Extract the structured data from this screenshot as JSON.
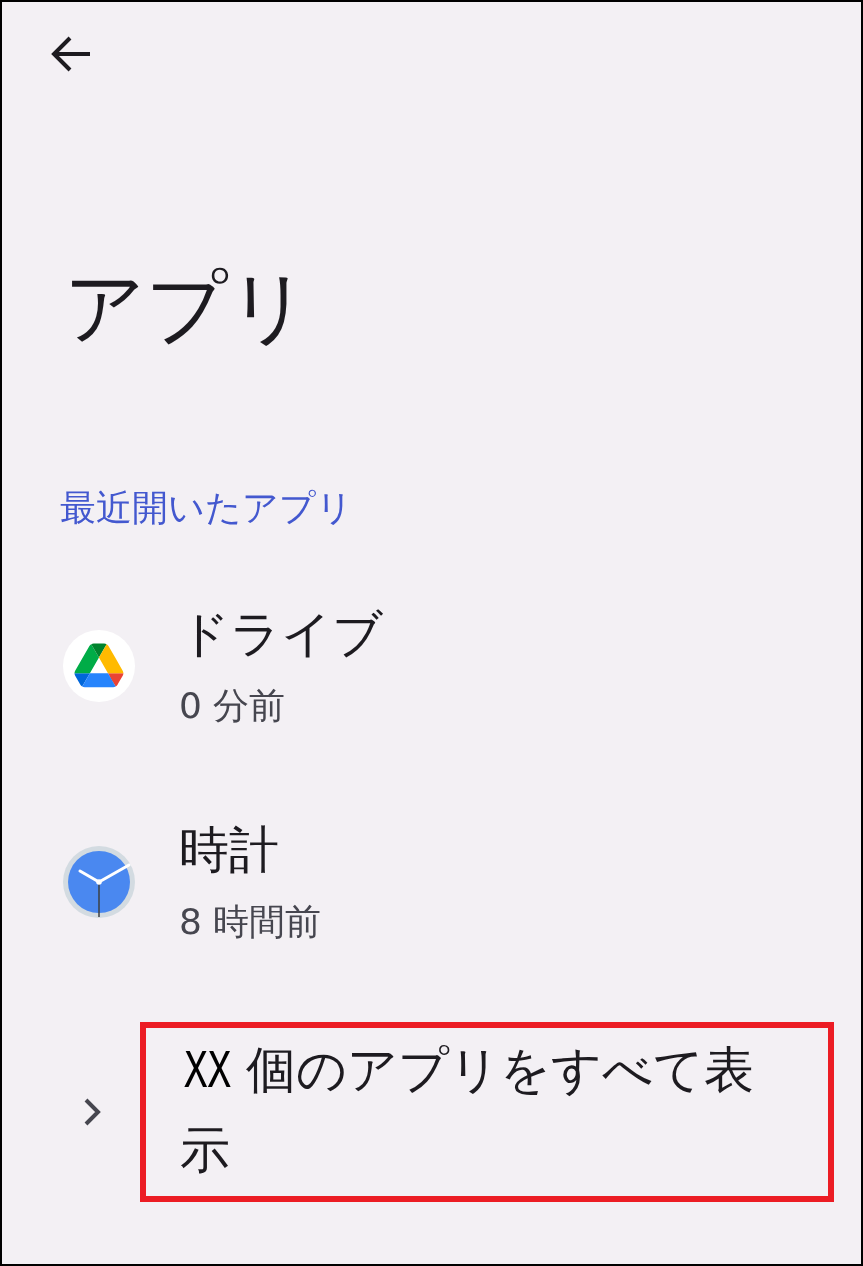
{
  "title": "アプリ",
  "section": {
    "header": "最近開いたアプリ",
    "apps": [
      {
        "kind": "drive",
        "name": "ドライブ",
        "time": "0 分前"
      },
      {
        "kind": "clock",
        "name": "時計",
        "time": "8 時間前"
      }
    ]
  },
  "show_all": {
    "count": "XX",
    "label": "個のアプリをすべて表示",
    "highlighted": true
  }
}
